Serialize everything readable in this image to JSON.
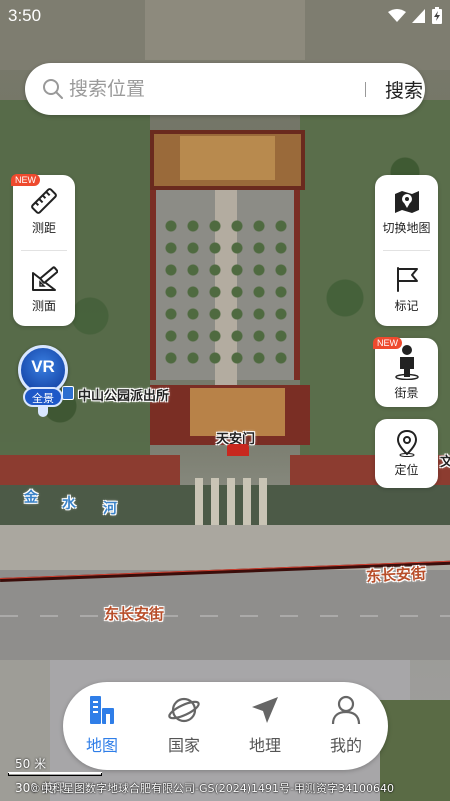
{
  "status_bar": {
    "time": "3:50",
    "icons": [
      "wifi-icon",
      "signal-icon",
      "battery-charging-icon"
    ]
  },
  "search": {
    "placeholder": "搜索位置",
    "button_label": "搜索",
    "icon": "search-icon"
  },
  "left_tools": {
    "new_badge": "NEW",
    "items": [
      {
        "label": "测距",
        "icon": "ruler-icon"
      },
      {
        "label": "测面",
        "icon": "area-measure-icon"
      }
    ]
  },
  "right_tools": {
    "items": [
      {
        "label": "切换地图",
        "icon": "map-layers-icon"
      },
      {
        "label": "标记",
        "icon": "flag-icon"
      }
    ]
  },
  "street_view": {
    "label": "街景",
    "new_badge": "NEW",
    "icon": "person-icon"
  },
  "locate": {
    "label": "定位",
    "icon": "location-pin-icon"
  },
  "vr": {
    "text": "VR",
    "sub": "全景"
  },
  "map_labels": {
    "poi_1": "中山公园派出所",
    "poi_2": "天安门",
    "poi_edge": "文",
    "water_1": "金",
    "water_2": "水",
    "water_3": "河",
    "road_1": "东长安街",
    "road_2": "东长安街"
  },
  "tabs": [
    {
      "label": "地图",
      "icon": "building-icon",
      "active": true
    },
    {
      "label": "国家",
      "icon": "planet-icon",
      "active": false
    },
    {
      "label": "地理",
      "icon": "navigation-arrow-icon",
      "active": false
    },
    {
      "label": "我的",
      "icon": "user-icon",
      "active": false
    }
  ],
  "scale": {
    "upper": "50 米",
    "lower": "300 英尺"
  },
  "copyright": "©中科星图数字地球合肥有限公司-GS(2024)1491号-甲测资字34100640",
  "colors": {
    "accent": "#2f7ee8",
    "badge": "#ee4a2e",
    "vr_blue": "#1e58c8"
  }
}
